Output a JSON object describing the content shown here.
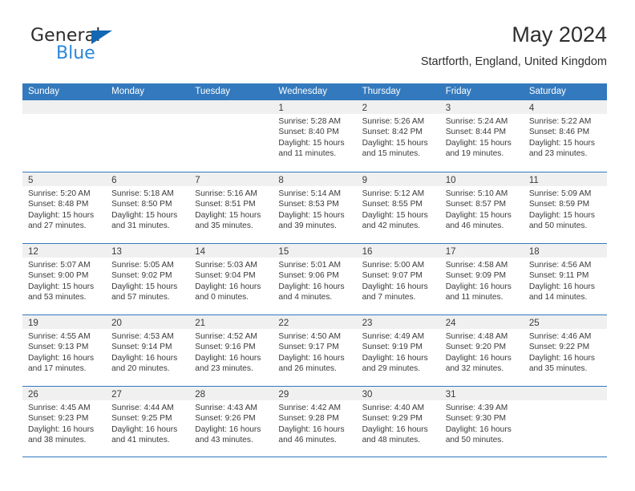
{
  "brand": {
    "name_top": "General",
    "name_bottom": "Blue",
    "triangle_color": "#1268b3",
    "blue_color": "#2b87d8"
  },
  "header": {
    "title": "May 2024",
    "subtitle": "Startforth, England, United Kingdom"
  },
  "theme": {
    "header_blue": "#3379bd",
    "daynum_band": "#f0f0f0",
    "text": "#3a3a3a"
  },
  "weekdays": [
    "Sunday",
    "Monday",
    "Tuesday",
    "Wednesday",
    "Thursday",
    "Friday",
    "Saturday"
  ],
  "weeks": [
    [
      {
        "day": "",
        "lines": []
      },
      {
        "day": "",
        "lines": []
      },
      {
        "day": "",
        "lines": []
      },
      {
        "day": "1",
        "lines": [
          "Sunrise: 5:28 AM",
          "Sunset: 8:40 PM",
          "Daylight: 15 hours",
          "and 11 minutes."
        ]
      },
      {
        "day": "2",
        "lines": [
          "Sunrise: 5:26 AM",
          "Sunset: 8:42 PM",
          "Daylight: 15 hours",
          "and 15 minutes."
        ]
      },
      {
        "day": "3",
        "lines": [
          "Sunrise: 5:24 AM",
          "Sunset: 8:44 PM",
          "Daylight: 15 hours",
          "and 19 minutes."
        ]
      },
      {
        "day": "4",
        "lines": [
          "Sunrise: 5:22 AM",
          "Sunset: 8:46 PM",
          "Daylight: 15 hours",
          "and 23 minutes."
        ]
      }
    ],
    [
      {
        "day": "5",
        "lines": [
          "Sunrise: 5:20 AM",
          "Sunset: 8:48 PM",
          "Daylight: 15 hours",
          "and 27 minutes."
        ]
      },
      {
        "day": "6",
        "lines": [
          "Sunrise: 5:18 AM",
          "Sunset: 8:50 PM",
          "Daylight: 15 hours",
          "and 31 minutes."
        ]
      },
      {
        "day": "7",
        "lines": [
          "Sunrise: 5:16 AM",
          "Sunset: 8:51 PM",
          "Daylight: 15 hours",
          "and 35 minutes."
        ]
      },
      {
        "day": "8",
        "lines": [
          "Sunrise: 5:14 AM",
          "Sunset: 8:53 PM",
          "Daylight: 15 hours",
          "and 39 minutes."
        ]
      },
      {
        "day": "9",
        "lines": [
          "Sunrise: 5:12 AM",
          "Sunset: 8:55 PM",
          "Daylight: 15 hours",
          "and 42 minutes."
        ]
      },
      {
        "day": "10",
        "lines": [
          "Sunrise: 5:10 AM",
          "Sunset: 8:57 PM",
          "Daylight: 15 hours",
          "and 46 minutes."
        ]
      },
      {
        "day": "11",
        "lines": [
          "Sunrise: 5:09 AM",
          "Sunset: 8:59 PM",
          "Daylight: 15 hours",
          "and 50 minutes."
        ]
      }
    ],
    [
      {
        "day": "12",
        "lines": [
          "Sunrise: 5:07 AM",
          "Sunset: 9:00 PM",
          "Daylight: 15 hours",
          "and 53 minutes."
        ]
      },
      {
        "day": "13",
        "lines": [
          "Sunrise: 5:05 AM",
          "Sunset: 9:02 PM",
          "Daylight: 15 hours",
          "and 57 minutes."
        ]
      },
      {
        "day": "14",
        "lines": [
          "Sunrise: 5:03 AM",
          "Sunset: 9:04 PM",
          "Daylight: 16 hours",
          "and 0 minutes."
        ]
      },
      {
        "day": "15",
        "lines": [
          "Sunrise: 5:01 AM",
          "Sunset: 9:06 PM",
          "Daylight: 16 hours",
          "and 4 minutes."
        ]
      },
      {
        "day": "16",
        "lines": [
          "Sunrise: 5:00 AM",
          "Sunset: 9:07 PM",
          "Daylight: 16 hours",
          "and 7 minutes."
        ]
      },
      {
        "day": "17",
        "lines": [
          "Sunrise: 4:58 AM",
          "Sunset: 9:09 PM",
          "Daylight: 16 hours",
          "and 11 minutes."
        ]
      },
      {
        "day": "18",
        "lines": [
          "Sunrise: 4:56 AM",
          "Sunset: 9:11 PM",
          "Daylight: 16 hours",
          "and 14 minutes."
        ]
      }
    ],
    [
      {
        "day": "19",
        "lines": [
          "Sunrise: 4:55 AM",
          "Sunset: 9:13 PM",
          "Daylight: 16 hours",
          "and 17 minutes."
        ]
      },
      {
        "day": "20",
        "lines": [
          "Sunrise: 4:53 AM",
          "Sunset: 9:14 PM",
          "Daylight: 16 hours",
          "and 20 minutes."
        ]
      },
      {
        "day": "21",
        "lines": [
          "Sunrise: 4:52 AM",
          "Sunset: 9:16 PM",
          "Daylight: 16 hours",
          "and 23 minutes."
        ]
      },
      {
        "day": "22",
        "lines": [
          "Sunrise: 4:50 AM",
          "Sunset: 9:17 PM",
          "Daylight: 16 hours",
          "and 26 minutes."
        ]
      },
      {
        "day": "23",
        "lines": [
          "Sunrise: 4:49 AM",
          "Sunset: 9:19 PM",
          "Daylight: 16 hours",
          "and 29 minutes."
        ]
      },
      {
        "day": "24",
        "lines": [
          "Sunrise: 4:48 AM",
          "Sunset: 9:20 PM",
          "Daylight: 16 hours",
          "and 32 minutes."
        ]
      },
      {
        "day": "25",
        "lines": [
          "Sunrise: 4:46 AM",
          "Sunset: 9:22 PM",
          "Daylight: 16 hours",
          "and 35 minutes."
        ]
      }
    ],
    [
      {
        "day": "26",
        "lines": [
          "Sunrise: 4:45 AM",
          "Sunset: 9:23 PM",
          "Daylight: 16 hours",
          "and 38 minutes."
        ]
      },
      {
        "day": "27",
        "lines": [
          "Sunrise: 4:44 AM",
          "Sunset: 9:25 PM",
          "Daylight: 16 hours",
          "and 41 minutes."
        ]
      },
      {
        "day": "28",
        "lines": [
          "Sunrise: 4:43 AM",
          "Sunset: 9:26 PM",
          "Daylight: 16 hours",
          "and 43 minutes."
        ]
      },
      {
        "day": "29",
        "lines": [
          "Sunrise: 4:42 AM",
          "Sunset: 9:28 PM",
          "Daylight: 16 hours",
          "and 46 minutes."
        ]
      },
      {
        "day": "30",
        "lines": [
          "Sunrise: 4:40 AM",
          "Sunset: 9:29 PM",
          "Daylight: 16 hours",
          "and 48 minutes."
        ]
      },
      {
        "day": "31",
        "lines": [
          "Sunrise: 4:39 AM",
          "Sunset: 9:30 PM",
          "Daylight: 16 hours",
          "and 50 minutes."
        ]
      },
      {
        "day": "",
        "lines": []
      }
    ]
  ]
}
